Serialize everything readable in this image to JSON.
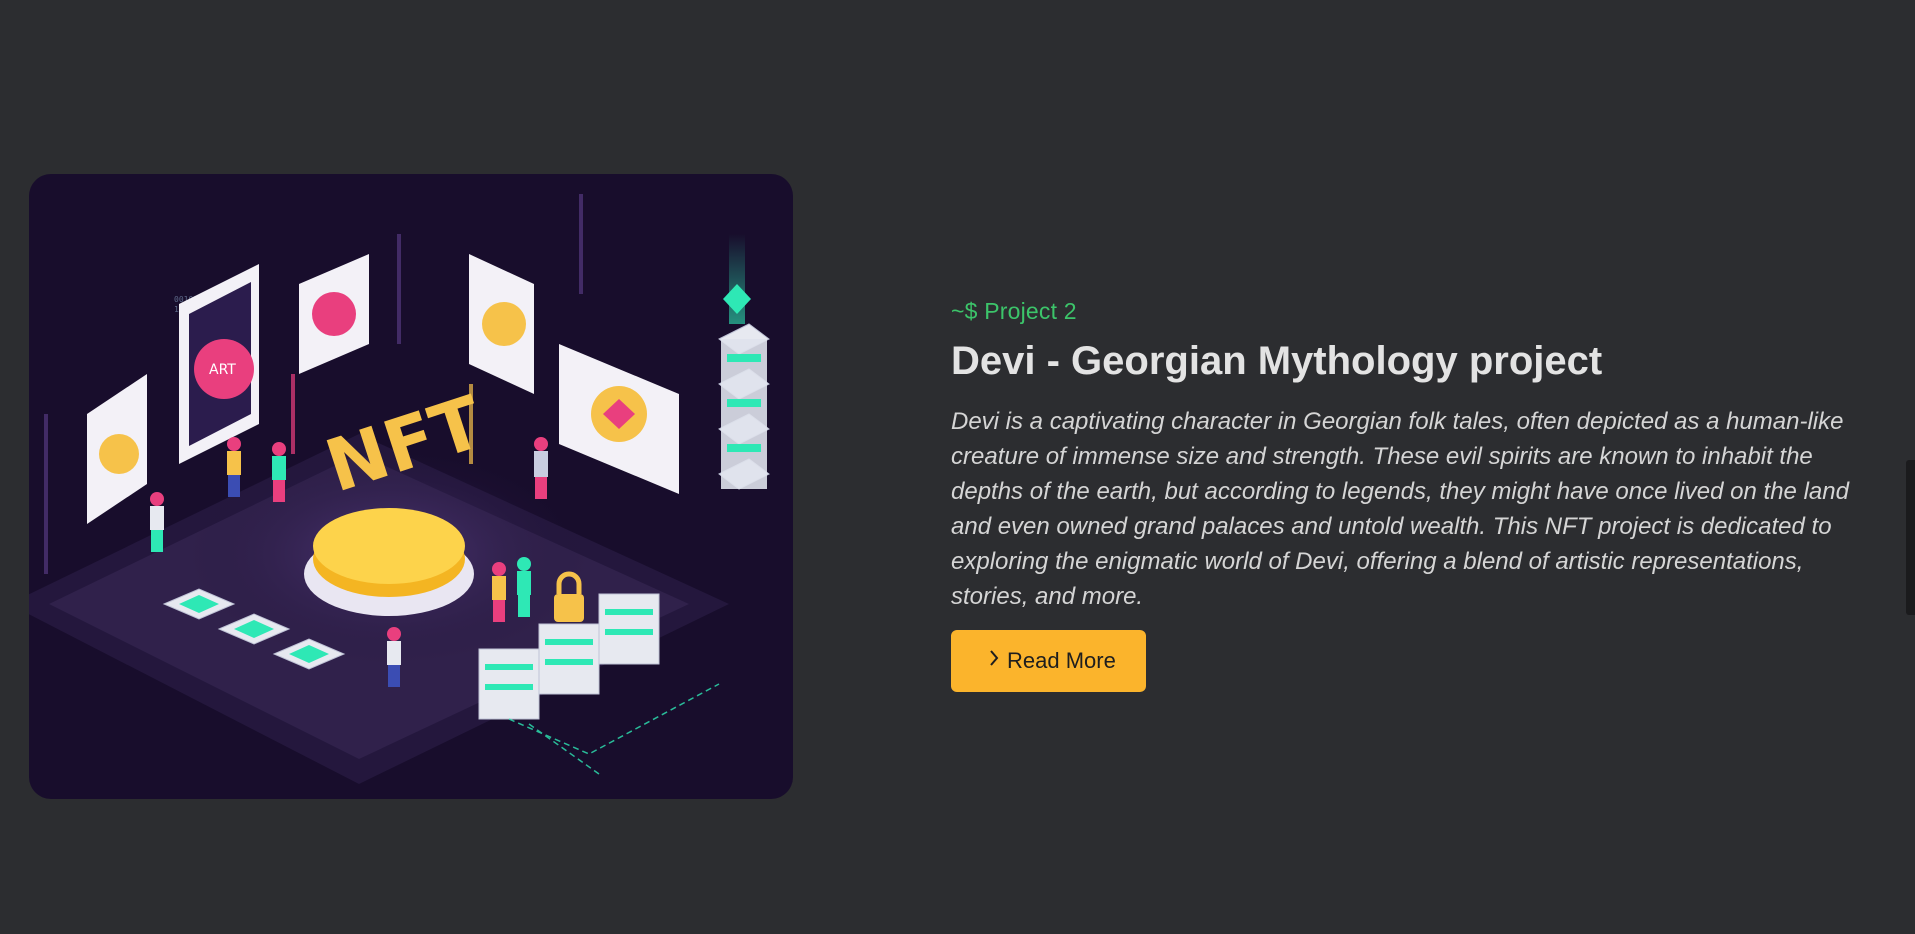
{
  "project": {
    "eyebrow": "~$ Project 2",
    "title": "Devi - Georgian Mythology project",
    "description": "Devi is a captivating character in Georgian folk tales, often depicted as a human-like creature of immense size and strength. These evil spirits are known to inhabit the depths of the earth, but according to legends, they might have once lived on the land and even owned grand palaces and untold wealth. This NFT project is dedicated to exploring the enigmatic world of Devi, offering a blend of artistic representations, stories, and more.",
    "cta_label": "Read More",
    "cta_icon": "chevron-right-icon"
  },
  "illustration": {
    "nft_text": "NFT",
    "art_text": "ART"
  },
  "colors": {
    "background": "#2c2d30",
    "accent_green": "#3cc46a",
    "button": "#fbb42c",
    "image_bg": "#180d2c"
  }
}
